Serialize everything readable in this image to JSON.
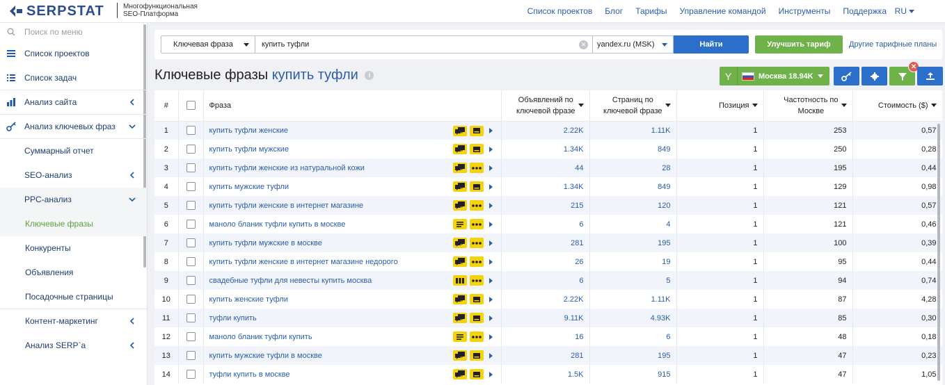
{
  "header": {
    "logo_text": "SERPSTAT",
    "logo_sub1": "Многофункциональная",
    "logo_sub2": "SEO-Платформа",
    "nav": [
      "Список проектов",
      "Блог",
      "Тарифы",
      "Управление командой",
      "Инструменты",
      "Поддержка"
    ],
    "lang": "RU"
  },
  "sidebar": {
    "search_placeholder": "Поиск по меню",
    "items": [
      {
        "label": "Список проектов"
      },
      {
        "label": "Список задач"
      },
      {
        "label": "Анализ сайта"
      },
      {
        "label": "Анализ ключевых фраз"
      },
      {
        "label": "Суммарный отчет"
      },
      {
        "label": "SEO-анализ"
      },
      {
        "label": "PPC-анализ"
      },
      {
        "label": "Ключевые фразы"
      },
      {
        "label": "Конкуренты"
      },
      {
        "label": "Объявления"
      },
      {
        "label": "Посадочные страницы"
      },
      {
        "label": "Контент-маркетинг"
      },
      {
        "label": "Анализ SERP`a"
      }
    ]
  },
  "search": {
    "type_label": "Ключевая фраза",
    "query": "купить туфли",
    "database": "yandex.ru (MSK)",
    "find_label": "Найти",
    "upgrade_label": "Улучшить тариф",
    "plans_link": "Другие тарифные планы"
  },
  "title": {
    "prefix": "Ключевые фразы",
    "keyword": "купить туфли",
    "region_label": "Москва 18.94K"
  },
  "table": {
    "headers": {
      "num": "#",
      "phrase": "Фраза",
      "ads_line1": "Объявлений по",
      "ads_line2": "ключевой фразе",
      "pages_line1": "Страниц по",
      "pages_line2": "ключевой фразе",
      "position": "Позиция",
      "freq_line1": "Частотность по",
      "freq_line2": "Москве",
      "cost": "Стоимость ($)"
    },
    "rows": [
      {
        "n": "1",
        "phrase": "купить туфли женские",
        "f": [
          "chat",
          "card"
        ],
        "ads": "2.22K",
        "pages": "1.11K",
        "pos": "1",
        "freq": "253",
        "cost": "0,57"
      },
      {
        "n": "2",
        "phrase": "купить туфли мужские",
        "f": [
          "chat",
          "card"
        ],
        "ads": "1.34K",
        "pages": "849",
        "pos": "1",
        "freq": "250",
        "cost": "0,28"
      },
      {
        "n": "3",
        "phrase": "купить туфли женские из натуральной кожи",
        "f": [
          "chat",
          "dots"
        ],
        "ads": "44",
        "pages": "28",
        "pos": "1",
        "freq": "195",
        "cost": "0,44"
      },
      {
        "n": "4",
        "phrase": "купить мужские туфли",
        "f": [
          "chat",
          "card"
        ],
        "ads": "1.34K",
        "pages": "849",
        "pos": "1",
        "freq": "129",
        "cost": "0,98"
      },
      {
        "n": "5",
        "phrase": "купить туфли женские в интернет магазине",
        "f": [
          "chat",
          "dots"
        ],
        "ads": "215",
        "pages": "120",
        "pos": "1",
        "freq": "121",
        "cost": "0,57"
      },
      {
        "n": "6",
        "phrase": "маноло бланик туфли купить в москве",
        "f": [
          "lines",
          "dots"
        ],
        "ads": "6",
        "pages": "4",
        "pos": "1",
        "freq": "121",
        "cost": "0,46"
      },
      {
        "n": "7",
        "phrase": "купить туфли мужские в москве",
        "f": [
          "chat",
          "dots"
        ],
        "ads": "281",
        "pages": "195",
        "pos": "1",
        "freq": "100",
        "cost": "0,39"
      },
      {
        "n": "8",
        "phrase": "купить туфли женские в интернет магазине недорого",
        "f": [
          "chat",
          "dots"
        ],
        "ads": "26",
        "pages": "19",
        "pos": "1",
        "freq": "95",
        "cost": "0,44"
      },
      {
        "n": "9",
        "phrase": "свадебные туфли для невесты купить москва",
        "f": [
          "bars",
          "dots"
        ],
        "ads": "6",
        "pages": "5",
        "pos": "1",
        "freq": "94",
        "cost": "0,74"
      },
      {
        "n": "10",
        "phrase": "купить женские туфли",
        "f": [
          "chat",
          "card"
        ],
        "ads": "2.22K",
        "pages": "1.11K",
        "pos": "1",
        "freq": "87",
        "cost": "4,28"
      },
      {
        "n": "11",
        "phrase": "туфли купить",
        "f": [
          "chat",
          "card"
        ],
        "ads": "9.11K",
        "pages": "4.93K",
        "pos": "1",
        "freq": "85",
        "cost": "0,30"
      },
      {
        "n": "12",
        "phrase": "маноло бланик туфли купить",
        "f": [
          "lines",
          "dots"
        ],
        "ads": "16",
        "pages": "6",
        "pos": "1",
        "freq": "48",
        "cost": "0,18"
      },
      {
        "n": "13",
        "phrase": "купить мужские туфли в москве",
        "f": [
          "chat",
          "card"
        ],
        "ads": "281",
        "pages": "195",
        "pos": "1",
        "freq": "47",
        "cost": "0,23"
      },
      {
        "n": "14",
        "phrase": "туфли купить в москве",
        "f": [
          "chat",
          "card"
        ],
        "ads": "1.5K",
        "pages": "915",
        "pos": "1",
        "freq": "47",
        "cost": "1,05"
      }
    ]
  },
  "colors": {
    "brand_blue": "#2c6fcb",
    "green": "#6fb24a",
    "feature_yellow": "#f5d30a",
    "link": "#2a5caa"
  }
}
